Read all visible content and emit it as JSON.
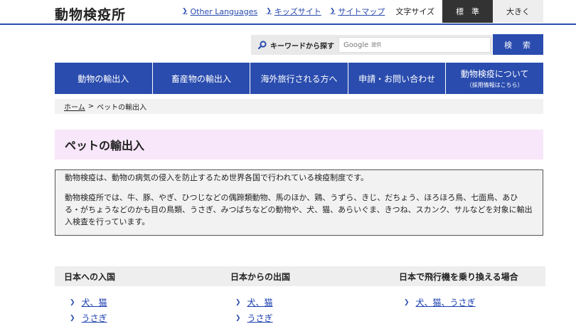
{
  "header": {
    "logo": "動物検疫所",
    "links": [
      "Other Languages",
      "キッズサイト",
      "サイトマップ"
    ],
    "font_size_label": "文字サイズ",
    "font_standard": "標　準",
    "font_large": "大きく"
  },
  "search": {
    "label": "キーワードから探す",
    "google_label": "Google",
    "placeholder": "提供",
    "button": "検　索"
  },
  "nav": {
    "items": [
      {
        "label": "動物の輸出入"
      },
      {
        "label": "畜産物の輸出入"
      },
      {
        "label": "海外旅行される方へ"
      },
      {
        "label": "申請・お問い合わせ"
      },
      {
        "label": "動物検疫について",
        "sub": "（採用情報はこちら）"
      }
    ]
  },
  "breadcrumb": {
    "home": "ホーム",
    "separator": ">",
    "current": "ペットの輸出入"
  },
  "page": {
    "title": "ペットの輸出入",
    "intro": "動物検疫は、動物の病気の侵入を防止するため世界各国で行われている検疫制度です。",
    "body": "動物検疫所では、牛、豚、やぎ、ひつじなどの偶蹄類動物、馬のほか、鶏、うずら、きじ、だちょう、ほろほろ鳥、七面鳥、あひる・がちょうなどのかも目の鳥類、うさぎ、みつばちなどの動物や、犬、猫、あらいぐま、きつね、スカンク、サルなどを対象に輸出入検査を行っています。"
  },
  "columns": [
    {
      "title": "日本への入国",
      "links": [
        "犬、猫",
        "うさぎ"
      ]
    },
    {
      "title": "日本からの出国",
      "links": [
        "犬、猫",
        "うさぎ"
      ]
    },
    {
      "title": "日本で飛行機を乗り換える場合",
      "links": [
        "犬、猫、うさぎ"
      ]
    }
  ],
  "colors": {
    "brand_blue": "#2a4cae",
    "title_bg": "#f8e6fa",
    "active_font_btn": "#333333"
  }
}
